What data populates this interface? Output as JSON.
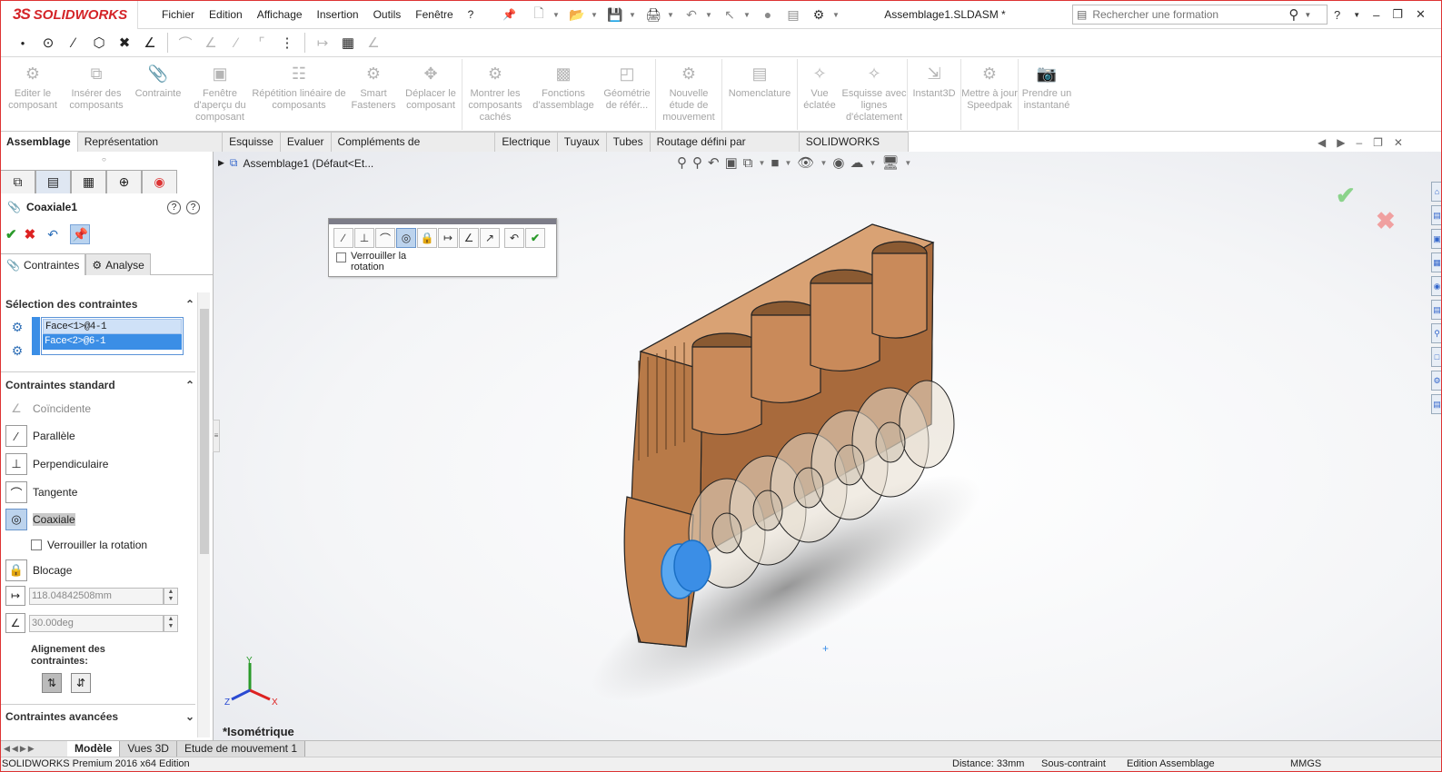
{
  "app": {
    "logo_ds": "3S",
    "logo_text": "SOLIDWORKS",
    "brand_color": "#d42428"
  },
  "menu": [
    "Fichier",
    "Edition",
    "Affichage",
    "Insertion",
    "Outils",
    "Fenêtre",
    "?"
  ],
  "document_title": "Assemblage1.SLDASM *",
  "search": {
    "placeholder": "Rechercher une formation"
  },
  "command_buttons": [
    {
      "label": "Editer le composant",
      "icon": "edit-component-icon"
    },
    {
      "label": "Insérer des composants",
      "icon": "insert-components-icon"
    },
    {
      "label": "Contrainte",
      "icon": "mate-icon"
    },
    {
      "label": "Fenêtre d'aperçu du composant",
      "icon": "preview-window-icon"
    },
    {
      "label": "Répétition linéaire de composants",
      "icon": "linear-pattern-icon"
    },
    {
      "label": "Smart Fasteners",
      "icon": "smart-fasteners-icon"
    },
    {
      "label": "Déplacer le composant",
      "icon": "move-component-icon"
    },
    {
      "label": "Montrer les composants cachés",
      "icon": "show-hidden-icon"
    },
    {
      "label": "Fonctions d'assemblage",
      "icon": "assembly-features-icon"
    },
    {
      "label": "Géométrie de référ...",
      "icon": "reference-geometry-icon"
    },
    {
      "label": "Nouvelle étude de mouvement",
      "icon": "motion-study-icon"
    },
    {
      "label": "Nomenclature",
      "icon": "bom-icon"
    },
    {
      "label": "Vue éclatée",
      "icon": "exploded-view-icon"
    },
    {
      "label": "Esquisse avec lignes d'éclatement",
      "icon": "explode-line-sketch-icon"
    },
    {
      "label": "Instant3D",
      "icon": "instant3d-icon"
    },
    {
      "label": "Mettre à jour Speedpak",
      "icon": "speedpak-icon"
    },
    {
      "label": "Prendre un instantané",
      "icon": "snapshot-icon"
    }
  ],
  "tabs": [
    "Assemblage",
    "Représentation schématique",
    "Esquisse",
    "Evaluer",
    "Compléments de SOLIDWORKS",
    "Electrique",
    "Tuyaux",
    "Tubes",
    "Routage défini par l'utilisateur",
    "SOLIDWORKS MBD"
  ],
  "tree": {
    "root": "Assemblage1  (Défaut<Et..."
  },
  "property_manager": {
    "title": "Coaxiale1",
    "subtab_mates": "Contraintes",
    "subtab_analysis": "Analyse",
    "selection_section": "Sélection des contraintes",
    "selections": [
      "Face<1>@4-1",
      "Face<2>@6-1"
    ],
    "standard_section": "Contraintes standard",
    "mates": {
      "coincident": "Coïncidente",
      "parallel": "Parallèle",
      "perpendicular": "Perpendiculaire",
      "tangent": "Tangente",
      "coaxial": "Coaxiale",
      "lock_rotation": "Verrouiller la rotation",
      "lock": "Blocage"
    },
    "distance_value": "118.04842508mm",
    "angle_value": "30.00deg",
    "alignment_label": "Alignement des contraintes:",
    "advanced_section": "Contraintes avancées"
  },
  "popup": {
    "lock_rotation": "Verrouiller la rotation"
  },
  "view_label": "*Isométrique",
  "triad": {
    "x": "X",
    "y": "Y",
    "z": "Z"
  },
  "bottom_tabs": [
    "Modèle",
    "Vues 3D",
    "Etude de mouvement 1"
  ],
  "status": {
    "left": "SOLIDWORKS Premium 2016 x64 Edition",
    "mid1": "Distance: 33mm",
    "mid2": "Sous-contraint",
    "mid3": "Edition Assemblage",
    "right": "MMGS"
  },
  "colors": {
    "part": "#c98a5a",
    "selection": "#3b8ee6"
  }
}
